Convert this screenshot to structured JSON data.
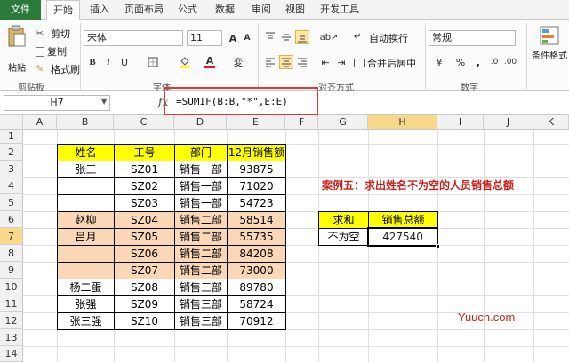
{
  "tabs": [
    "文件",
    "开始",
    "插入",
    "页面布局",
    "公式",
    "数据",
    "审阅",
    "视图",
    "开发工具"
  ],
  "ribbon": {
    "paste_label": "粘贴",
    "cut_label": "剪切",
    "copy_label": "复制",
    "format_painter_label": "格式刷",
    "clipboard_group": "剪贴板",
    "font_name": "宋体",
    "font_size": "11",
    "font_group": "字体",
    "wrap_text_label": "自动换行",
    "merge_center_label": "合并后居中",
    "alignment_group": "对齐方式",
    "number_format": "常规",
    "number_group": "数字",
    "conditional_format_label": "条件格式"
  },
  "formula_bar": {
    "name_box": "H7",
    "fx_label": "fx",
    "formula": "=SUMIF(B:B,\"*\",E:E)"
  },
  "columns": [
    "A",
    "B",
    "C",
    "D",
    "E",
    "F",
    "G",
    "H",
    "I",
    "J",
    "K"
  ],
  "rows": [
    "1",
    "2",
    "3",
    "4",
    "5",
    "6",
    "7",
    "8",
    "9",
    "10",
    "11",
    "12",
    "13",
    "14"
  ],
  "table": {
    "headers": [
      "姓名",
      "工号",
      "部门",
      "12月销售额"
    ],
    "rows": [
      [
        "张三",
        "SZ01",
        "销售一部",
        "93875"
      ],
      [
        "",
        "SZ02",
        "销售一部",
        "71020"
      ],
      [
        "",
        "SZ03",
        "销售一部",
        "54723"
      ],
      [
        "赵柳",
        "SZ04",
        "销售二部",
        "58514"
      ],
      [
        "吕月",
        "SZ05",
        "销售二部",
        "55735"
      ],
      [
        "",
        "SZ06",
        "销售二部",
        "84208"
      ],
      [
        "",
        "SZ07",
        "销售二部",
        "73000"
      ],
      [
        "杨二蛋",
        "SZ08",
        "销售三部",
        "89780"
      ],
      [
        "张强",
        "SZ09",
        "销售三部",
        "58724"
      ],
      [
        "张三强",
        "SZ10",
        "销售三部",
        "70912"
      ]
    ]
  },
  "case_title": "案例五：求出姓名不为空的人员销售总额",
  "summary": {
    "header_label": "求和",
    "header_value": "销售总额",
    "row_label": "不为空",
    "row_value": "427540"
  },
  "watermark": "Yuucn.com",
  "colors": {
    "header_yellow": "#ffff00",
    "peach": "#fad7b5",
    "accent_red": "#c8221d",
    "file_tab_green": "#2a7a3a"
  }
}
